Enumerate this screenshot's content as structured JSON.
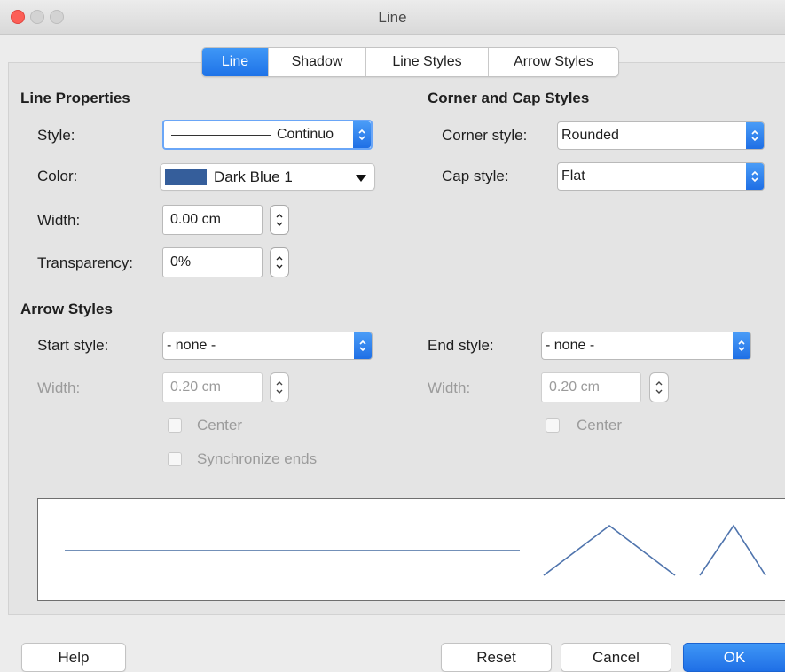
{
  "window": {
    "title": "Line"
  },
  "tabs": [
    {
      "label": "Line",
      "active": true
    },
    {
      "label": "Shadow"
    },
    {
      "label": "Line Styles"
    },
    {
      "label": "Arrow Styles"
    }
  ],
  "line_properties": {
    "heading": "Line Properties",
    "style_label": "Style:",
    "style_value": "Continuo",
    "color_label": "Color:",
    "color_value": "Dark Blue 1",
    "color_swatch": "#355e9b",
    "width_label": "Width:",
    "width_value": "0.00 cm",
    "transparency_label": "Transparency:",
    "transparency_value": "0%"
  },
  "corner_cap": {
    "heading": "Corner and Cap Styles",
    "corner_label": "Corner style:",
    "corner_value": "Rounded",
    "cap_label": "Cap style:",
    "cap_value": "Flat"
  },
  "arrow_styles": {
    "heading": "Arrow Styles",
    "start_label": "Start style:",
    "start_value": "- none -",
    "end_label": "End style:",
    "end_value": "- none -",
    "start_width_label": "Width:",
    "start_width_value": "0.20 cm",
    "end_width_label": "Width:",
    "end_width_value": "0.20 cm",
    "start_center_label": "Center",
    "end_center_label": "Center",
    "sync_label": "Synchronize ends"
  },
  "buttons": {
    "help": "Help",
    "reset": "Reset",
    "cancel": "Cancel",
    "ok": "OK"
  },
  "colors": {
    "accent": "#2a7ff0",
    "line_preview": "#7390b8",
    "traffic_close": "#fc5f57",
    "traffic_inactive": "#d0d0d0"
  }
}
